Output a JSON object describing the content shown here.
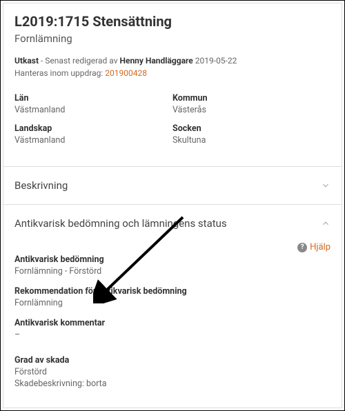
{
  "header": {
    "title": "L2019:1715 Stensättning",
    "subtitle": "Fornlämning",
    "status_strong": "Utkast",
    "status_text": " - Senast redigerad av ",
    "editor": "Henny Handläggare",
    "date": " 2019-05-22",
    "handled_prefix": "Hanteras inom uppdrag: ",
    "assignment": "201900428"
  },
  "loc": {
    "lan_label": "Län",
    "lan_value": "Västmanland",
    "landskap_label": "Landskap",
    "landskap_value": "Västmanland",
    "kommun_label": "Kommun",
    "kommun_value": "Västerås",
    "socken_label": "Socken",
    "socken_value": "Skultuna"
  },
  "sections": {
    "beskrivning": "Beskrivning",
    "bedomning": "Antikvarisk bedömning och lämningens status",
    "help": "Hjälp"
  },
  "fields": {
    "antik_bed_label": "Antikvarisk bedömning",
    "antik_bed_value": "Fornlämning - Förstörd",
    "rekom_label": "Rekommendation för antikvarisk bedömning",
    "rekom_value": "Fornlämning",
    "kommentar_label": "Antikvarisk kommentar",
    "kommentar_value": "–",
    "skada_label": "Grad av skada",
    "skada_value": "Förstörd",
    "skada_desc": "Skadebeskrivning: borta"
  }
}
